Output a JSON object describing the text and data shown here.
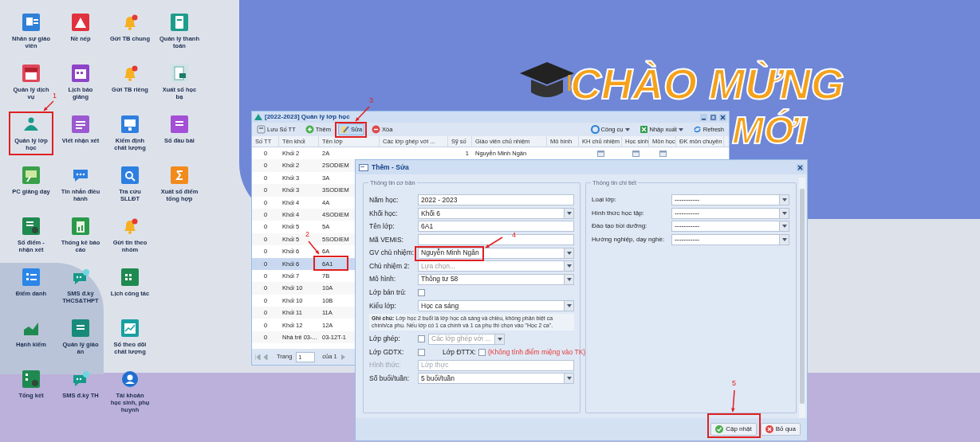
{
  "desktop": {
    "icon_rows": [
      [
        {
          "label": "Nhân sự giáo viên",
          "kind": "id_card"
        },
        {
          "label": "Nề nếp",
          "kind": "warning"
        },
        {
          "label": "Gửi TB chung",
          "kind": "bell"
        },
        {
          "label": "Quản lý thanh toán",
          "kind": "phone"
        }
      ],
      [
        {
          "label": "Quản lý dịch vụ",
          "kind": "shop"
        },
        {
          "label": "Lịch báo giảng",
          "kind": "calendar"
        },
        {
          "label": "Gửi TB riêng",
          "kind": "bell"
        },
        {
          "label": "Xuất sổ học bạ",
          "kind": "document"
        }
      ],
      [
        {
          "label": "Quản lý lớp học",
          "kind": "people"
        },
        {
          "label": "Viết nhận xét",
          "kind": "list"
        },
        {
          "label": "Kiểm định chất lượng",
          "kind": "monitor"
        },
        {
          "label": "Sổ đầu bài",
          "kind": "book"
        }
      ],
      [
        {
          "label": "PC giảng dạy",
          "kind": "board"
        },
        {
          "label": "Tin nhắn điều hành",
          "kind": "chat"
        },
        {
          "label": "Tra cứu SLLĐT",
          "kind": "search"
        },
        {
          "label": "Xuất sổ điểm tổng hợp",
          "kind": "sigma"
        }
      ],
      [
        {
          "label": "Sổ điểm - nhận xét",
          "kind": "gradebook"
        },
        {
          "label": "Thống kê báo cáo",
          "kind": "clipboard"
        },
        {
          "label": "Gửi tin theo nhóm",
          "kind": "bell"
        }
      ],
      [
        {
          "label": "Điểm danh",
          "kind": "list_blue"
        },
        {
          "label": "SMS đ.ký THCS&THPT",
          "kind": "chat_home"
        },
        {
          "label": "Lịch công tác",
          "kind": "calendar_green"
        }
      ],
      [
        {
          "label": "Hạnh kiểm",
          "kind": "chart"
        },
        {
          "label": "Quản lý giáo án",
          "kind": "document_teal"
        },
        {
          "label": "Sổ theo dõi chất lượng",
          "kind": "chart_board"
        }
      ],
      [
        {
          "label": "Tổng kết",
          "kind": "summary"
        },
        {
          "label": "SMS đ.ký TH",
          "kind": "chat_home"
        },
        {
          "label": "Tài khoản học sinh, phụ huynh",
          "kind": "user"
        }
      ]
    ]
  },
  "banner": {
    "line_1": "CHÀO MỪNG",
    "line_2": "MỚI"
  },
  "grid_window": {
    "title": "[2022-2023] Quản lý lớp học",
    "toolbar_left": [
      {
        "label": "Lưu Số TT",
        "kind": "save",
        "selected": false
      },
      {
        "label": "Thêm",
        "kind": "add",
        "selected": false
      },
      {
        "label": "Sửa",
        "kind": "edit",
        "selected": true
      },
      {
        "label": "Xóa",
        "kind": "delete",
        "selected": false
      }
    ],
    "toolbar_right": [
      {
        "label": "Công cụ",
        "kind": "tools",
        "dropdown": true
      },
      {
        "label": "Nhập xuất",
        "kind": "excel",
        "dropdown": true
      },
      {
        "label": "Refresh",
        "kind": "refresh",
        "dropdown": false
      }
    ],
    "columns": [
      "Số TT",
      "Tên khối",
      "Tên lớp",
      "Các lớp ghép với ...",
      "Sỹ số",
      "Giáo viên chủ nhiệm",
      "Mô hình",
      "KH chủ nhiệm",
      "Học sinh",
      "Môn học",
      "ĐK môn chuyên"
    ],
    "rows": [
      {
        "no": "0",
        "grade": "Khối 2",
        "class": "2A",
        "size": "1",
        "teacher": "Nguyễn Minh Ngân",
        "selected": false
      },
      {
        "no": "0",
        "grade": "Khối 2",
        "class": "2SODIEM",
        "selected": false
      },
      {
        "no": "0",
        "grade": "Khối 3",
        "class": "3A",
        "selected": false
      },
      {
        "no": "0",
        "grade": "Khối 3",
        "class": "3SODIEM",
        "selected": false
      },
      {
        "no": "0",
        "grade": "Khối 4",
        "class": "4A",
        "selected": false
      },
      {
        "no": "0",
        "grade": "Khối 4",
        "class": "4SODIEM",
        "selected": false
      },
      {
        "no": "0",
        "grade": "Khối 5",
        "class": "5A",
        "selected": false
      },
      {
        "no": "0",
        "grade": "Khối 5",
        "class": "5SODIEM",
        "selected": false
      },
      {
        "no": "0",
        "grade": "Khối 6",
        "class": "6A",
        "selected": false
      },
      {
        "no": "0",
        "grade": "Khối 6",
        "class": "6A1",
        "selected": true
      },
      {
        "no": "0",
        "grade": "Khối 7",
        "class": "7B",
        "selected": false
      },
      {
        "no": "0",
        "grade": "Khối 10",
        "class": "10A",
        "selected": false
      },
      {
        "no": "0",
        "grade": "Khối 10",
        "class": "10B",
        "selected": false
      },
      {
        "no": "0",
        "grade": "Khối 11",
        "class": "11A",
        "selected": false
      },
      {
        "no": "0",
        "grade": "Khối 12",
        "class": "12A",
        "selected": false
      },
      {
        "no": "0",
        "grade": "Nhà trẻ 03-...",
        "class": "03-12T-1",
        "selected": false
      }
    ],
    "pager": {
      "label": "Trang",
      "page": "1",
      "total": "của 1"
    }
  },
  "dialog": {
    "title": "Thêm - Sửa",
    "basic": {
      "legend": "Thông tin cơ bản",
      "fields": [
        {
          "kind": "text",
          "label": "Năm học:",
          "value": "2022 - 2023"
        },
        {
          "kind": "select",
          "label": "Khối học:",
          "value": "Khối 6"
        },
        {
          "kind": "text",
          "label": "Tên lớp:",
          "value": "6A1"
        },
        {
          "kind": "text",
          "label": "Mã VEMIS:"
        },
        {
          "kind": "select",
          "label": "GV chủ nhiệm:",
          "value": "Nguyễn Minh Ngân"
        },
        {
          "kind": "select",
          "label": "Chủ nhiệm 2:",
          "placeholder": "Lựa chọn..."
        },
        {
          "kind": "select",
          "label": "Mô hình:",
          "value": "Thông tư 58"
        },
        {
          "kind": "checkbox",
          "label": "Lớp bán trú:",
          "checked": false
        },
        {
          "kind": "select",
          "label": "Kiểu lớp:",
          "value": "Học ca sáng"
        },
        {
          "kind": "note",
          "text": "**Ghi chú:** Lớp học 2 buổi là lớp học cả sáng và chiều, không phân biệt ca chính/ca phụ. Nếu lớp có 1 ca chính và 1 ca phụ thì chọn vào \"Học 2 ca\"."
        },
        {
          "kind": "checkbox_select",
          "label": "Lớp ghép:",
          "checked": false,
          "placeholder": "Các lớp ghép với ..."
        },
        {
          "kind": "checkbox_pair",
          "label": "Lớp GDTX:",
          "checked": false,
          "second_label": "Lớp ĐTTX:",
          "second_checked": false,
          "warning": "(Không tính điểm miệng vào TK)"
        },
        {
          "kind": "text",
          "label": "Hình thức:",
          "placeholder": "Lớp thực",
          "disabled": true
        },
        {
          "kind": "select",
          "label": "Số buổi/tuần:",
          "value": "5 buổi/tuần"
        }
      ]
    },
    "detail": {
      "legend": "Thông tin chi tiết",
      "fields": [
        {
          "label": "Loại lớp:",
          "value": "-----------"
        },
        {
          "label": "Hình thức học tập:",
          "value": "-----------"
        },
        {
          "label": "Đào tạo bồi dưỡng:",
          "value": "-----------"
        },
        {
          "label": "Hướng nghiệp, dạy nghề:",
          "value": "-----------"
        }
      ]
    },
    "buttons": [
      {
        "label": "Cập nhật",
        "kind": "ok"
      },
      {
        "label": "Bỏ qua",
        "kind": "cancel"
      }
    ]
  },
  "annotations": [
    {
      "label": "1"
    },
    {
      "label": "2"
    },
    {
      "label": "3"
    },
    {
      "label": "4"
    },
    {
      "label": "5"
    }
  ]
}
